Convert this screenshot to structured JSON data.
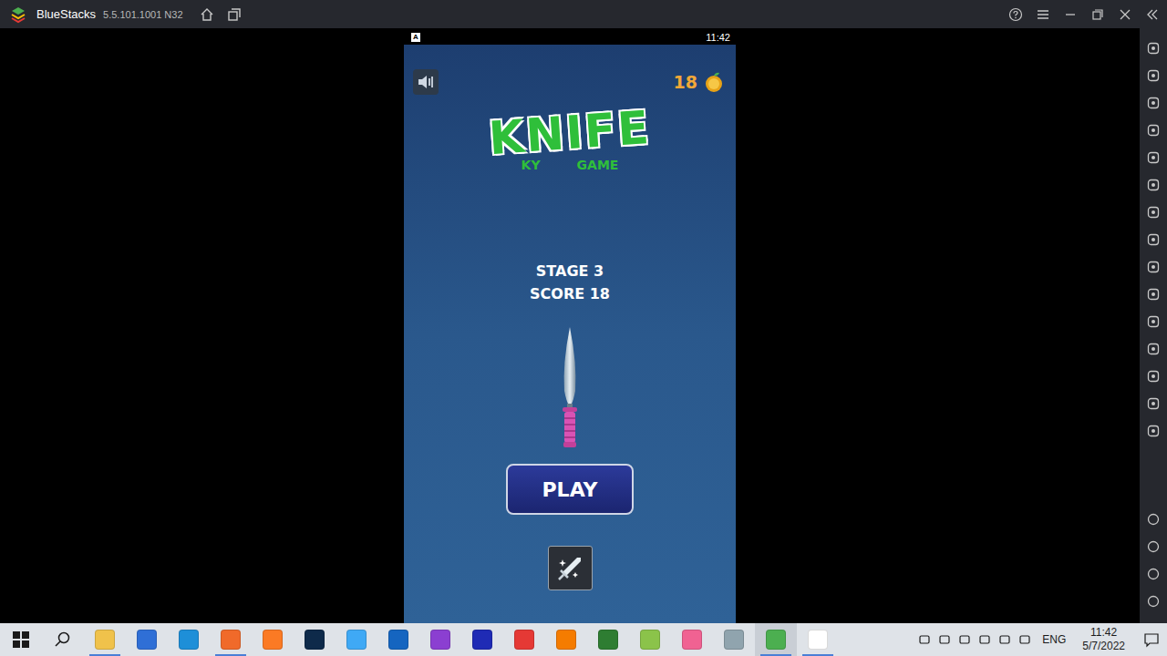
{
  "window": {
    "title": "BlueStacks",
    "version": "5.5.101.1001 N32"
  },
  "phone": {
    "status_icon": "A",
    "status_time": "11:42"
  },
  "game": {
    "apples": "18",
    "logo": {
      "title": "KNIFE",
      "subtitle_left": "KY",
      "subtitle_right": "GAME"
    },
    "stage": "STAGE 3",
    "score": "SCORE 18",
    "play_button": "PLAY"
  },
  "taskbar": {
    "apps": [
      {
        "name": "file-explorer",
        "running": true,
        "selected": false,
        "color": "#f0c24b"
      },
      {
        "name": "store",
        "running": false,
        "selected": false,
        "color": "#2f6fd6"
      },
      {
        "name": "edge",
        "running": false,
        "selected": false,
        "color": "#1e8fd8"
      },
      {
        "name": "firefox",
        "running": true,
        "selected": false,
        "color": "#f06a2a"
      },
      {
        "name": "xampp",
        "running": false,
        "selected": false,
        "color": "#fb7a24"
      },
      {
        "name": "photoshop",
        "running": false,
        "selected": false,
        "color": "#0e2a4a"
      },
      {
        "name": "paint-app",
        "running": false,
        "selected": false,
        "color": "#3fa9f5"
      },
      {
        "name": "word-app",
        "running": false,
        "selected": false,
        "color": "#1565c0"
      },
      {
        "name": "phpstorm",
        "running": false,
        "selected": false,
        "color": "#8b3fd1"
      },
      {
        "name": "intellij",
        "running": false,
        "selected": false,
        "color": "#1f2bb5"
      },
      {
        "name": "recorder",
        "running": false,
        "selected": false,
        "color": "#e53935"
      },
      {
        "name": "office-app",
        "running": false,
        "selected": false,
        "color": "#f57c00"
      },
      {
        "name": "money-app",
        "running": false,
        "selected": false,
        "color": "#2e7d32"
      },
      {
        "name": "tools-app",
        "running": false,
        "selected": false,
        "color": "#8bc34a"
      },
      {
        "name": "pen-app",
        "running": false,
        "selected": false,
        "color": "#f06292"
      },
      {
        "name": "utility-app",
        "running": false,
        "selected": false,
        "color": "#90a4ae"
      },
      {
        "name": "bluestacks",
        "running": true,
        "selected": true,
        "color": "#4caf50"
      },
      {
        "name": "notepad",
        "running": true,
        "selected": false,
        "color": "#ffffff"
      }
    ],
    "tray": {
      "language": "ENG",
      "time": "11:42",
      "date": "5/7/2022"
    }
  }
}
